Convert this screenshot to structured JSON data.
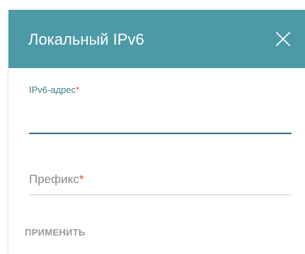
{
  "dialog": {
    "title": "Локальный IPv6",
    "close_icon": "close-icon"
  },
  "fields": {
    "ipv6": {
      "label": "IPv6-адрес",
      "required_mark": "*",
      "value": ""
    },
    "prefix": {
      "label": "Префикс",
      "required_mark": "*",
      "value": ""
    }
  },
  "actions": {
    "apply_label": "ПРИМЕНИТЬ"
  },
  "colors": {
    "header_bg": "#4b9aa6",
    "accent": "#2f6f7a",
    "required": "#e74c3c",
    "apply_disabled": "#9a9a9a"
  }
}
